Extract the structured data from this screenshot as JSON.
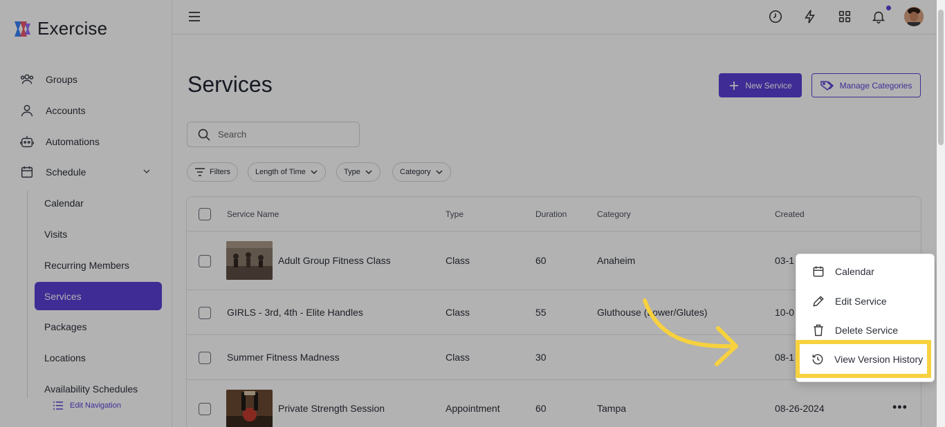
{
  "brand": {
    "name": "Exercise"
  },
  "sidebar": {
    "items": [
      {
        "label": "Groups",
        "icon": "users-icon"
      },
      {
        "label": "Accounts",
        "icon": "user-icon"
      },
      {
        "label": "Automations",
        "icon": "robot-icon"
      },
      {
        "label": "Schedule",
        "icon": "calendar-icon"
      }
    ],
    "schedule_sub": [
      {
        "label": "Calendar"
      },
      {
        "label": "Visits"
      },
      {
        "label": "Recurring Members"
      },
      {
        "label": "Services",
        "active": true
      },
      {
        "label": "Packages"
      },
      {
        "label": "Locations"
      },
      {
        "label": "Availability Schedules"
      }
    ],
    "edit_navigation": "Edit Navigation"
  },
  "topbar": {
    "icons": [
      "history-icon",
      "lightning-icon",
      "grid-icon",
      "bell-icon"
    ]
  },
  "page": {
    "title": "Services",
    "new_service": "New Service",
    "manage_categories": "Manage Categories",
    "search_placeholder": "Search",
    "filters": [
      "Filters",
      "Length of Time",
      "Type",
      "Category"
    ]
  },
  "table": {
    "headers": [
      "Service Name",
      "Type",
      "Duration",
      "Category",
      "Created"
    ],
    "rows": [
      {
        "name": "Adult Group Fitness Class",
        "type": "Class",
        "duration": "60",
        "category": "Anaheim",
        "created": "03-1",
        "has_image": true
      },
      {
        "name": "GIRLS - 3rd, 4th - Elite Handles",
        "type": "Class",
        "duration": "55",
        "category": "Gluthouse (Lower/Glutes)",
        "created": "10-0",
        "has_image": false
      },
      {
        "name": "Summer Fitness Madness",
        "type": "Class",
        "duration": "30",
        "category": "",
        "created": "08-1",
        "has_image": false
      },
      {
        "name": "Private Strength Session",
        "type": "Appointment",
        "duration": "60",
        "category": "Tampa",
        "created": "08-26-2024",
        "has_image": true
      }
    ]
  },
  "context_menu": {
    "items": [
      "Calendar",
      "Edit Service",
      "Delete Service"
    ],
    "highlighted": "View Version History"
  },
  "colors": {
    "accent": "#5b3fd6",
    "highlight": "#f7d13f"
  }
}
